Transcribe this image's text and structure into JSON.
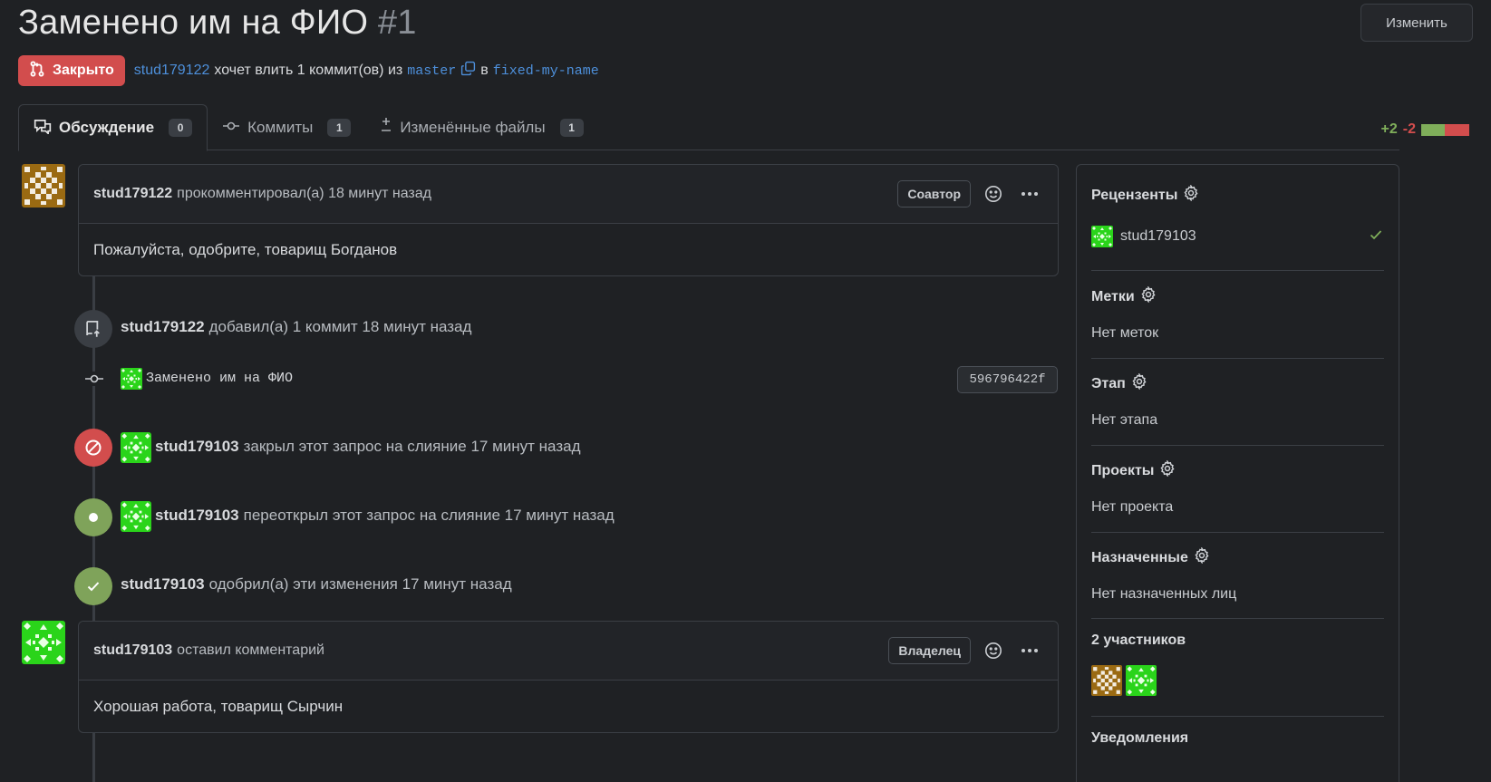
{
  "header": {
    "title": "Заменено им на ФИО",
    "number": "#1",
    "edit_label": "Изменить"
  },
  "meta": {
    "state": "Закрыто",
    "author": "stud179122",
    "text_wants": "хочет влить 1 коммит(ов) из",
    "source_branch": "master",
    "text_into": "в",
    "target_branch": "fixed-my-name"
  },
  "tabs": [
    {
      "label": "Обсуждение",
      "count": "0"
    },
    {
      "label": "Коммиты",
      "count": "1"
    },
    {
      "label": "Изменённые файлы",
      "count": "1"
    }
  ],
  "diffstat": {
    "additions": "+2",
    "deletions": "-2",
    "add_color": "#7fae5a",
    "del_color": "#d24d4d"
  },
  "timeline": {
    "comment1": {
      "author": "stud179122",
      "action": "прокомментировал(а) 18 минут назад",
      "role": "Соавтор",
      "body": "Пожалуйста, одобрите, товарищ Богданов"
    },
    "commit_event": {
      "author": "stud179122",
      "text": "добавил(а) 1 коммит 18 минут назад",
      "commit_message": "Заменено им на ФИО",
      "sha": "596796422f"
    },
    "closed_event": {
      "author": "stud179103",
      "text": "закрыл этот запрос на слияние 17 минут назад",
      "color": "#d24d4d"
    },
    "reopened_event": {
      "author": "stud179103",
      "text": "переоткрыл этот запрос на слияние 17 минут назад",
      "color": "#7fa35a"
    },
    "approved_event": {
      "author": "stud179103",
      "text": "одобрил(а) эти изменения 17 минут назад",
      "color": "#7fa35a"
    },
    "comment2": {
      "author": "stud179103",
      "action": "оставил комментарий",
      "role": "Владелец",
      "body": "Хорошая работа, товарищ Сырчин"
    }
  },
  "sidebar": {
    "reviewers": {
      "title": "Рецензенты",
      "name": "stud179103"
    },
    "labels": {
      "title": "Метки",
      "value": "Нет меток"
    },
    "milestone": {
      "title": "Этап",
      "value": "Нет этапа"
    },
    "projects": {
      "title": "Проекты",
      "value": "Нет проекта"
    },
    "assignees": {
      "title": "Назначенные",
      "value": "Нет назначенных лиц"
    },
    "participants": {
      "title": "2 участников"
    },
    "notifications": {
      "title": "Уведомления"
    }
  }
}
